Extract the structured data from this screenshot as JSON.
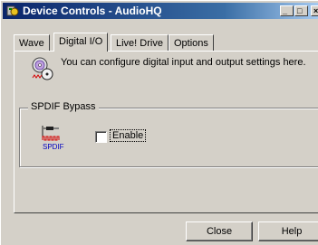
{
  "window": {
    "title": "Device Controls - AudioHQ",
    "app_icon": "audiohq-app-icon",
    "controls": [
      "minimize",
      "maximize",
      "close"
    ]
  },
  "tabs": [
    {
      "label": "Wave",
      "active": false
    },
    {
      "label": "Digital I/O",
      "active": true
    },
    {
      "label": "Live! Drive",
      "active": false
    },
    {
      "label": "Options",
      "active": false
    }
  ],
  "info": {
    "icon": "digital-io-cd-icon",
    "text": "You can configure digital input and output settings here."
  },
  "spdif_group": {
    "legend": "SPDIF Bypass",
    "icon": "spdif-connector-icon",
    "icon_text": "SPDIF",
    "checkbox_label": "Enable",
    "checked": false
  },
  "buttons": {
    "close": "Close",
    "help": "Help"
  },
  "colors": {
    "face": "#d4d0c8",
    "title_start": "#0a246a",
    "title_end": "#a6caf0",
    "spdif_red": "#d40000",
    "spdif_blue": "#0000c0"
  }
}
